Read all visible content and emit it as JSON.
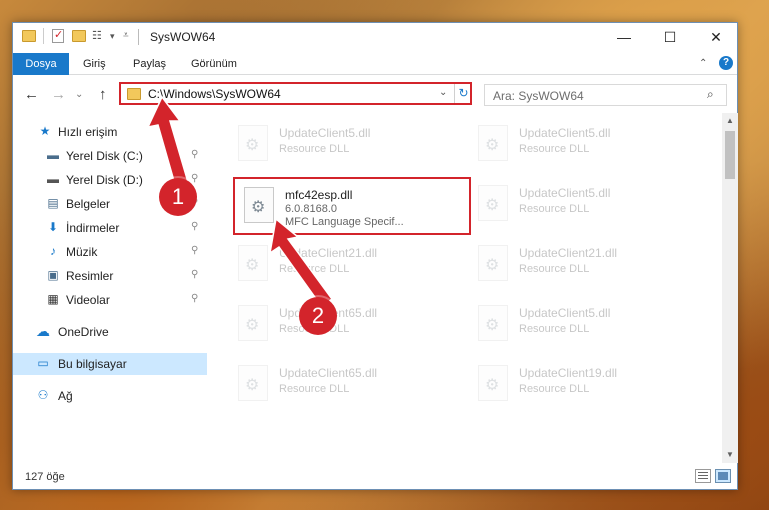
{
  "window": {
    "title": "SysWOW64",
    "min_glyph": "—",
    "max_glyph": "☐",
    "close_glyph": "✕"
  },
  "ribbon": {
    "tabs": [
      "Dosya",
      "Giriş",
      "Paylaş",
      "Görünüm"
    ],
    "collapse_glyph": "⌃",
    "help_glyph": "?"
  },
  "nav": {
    "back_glyph": "←",
    "forward_glyph": "→",
    "recent_glyph": "⌄",
    "up_glyph": "↑"
  },
  "address": {
    "path": "C:\\Windows\\SysWOW64",
    "dropdown_glyph": "⌄",
    "refresh_glyph": "↻"
  },
  "search": {
    "placeholder": "Ara: SysWOW64",
    "icon_glyph": "⌕"
  },
  "sidebar": {
    "items": [
      {
        "label": "Hızlı erişim",
        "icon": "star-icon",
        "glyph": "★",
        "pinned": false
      },
      {
        "label": "Yerel Disk (C:)",
        "icon": "drive-icon",
        "glyph": "▬",
        "pinned": true
      },
      {
        "label": "Yerel Disk (D:)",
        "icon": "drive-icon",
        "glyph": "▬",
        "pinned": true
      },
      {
        "label": "Belgeler",
        "icon": "documents-icon",
        "glyph": "▤",
        "pinned": true
      },
      {
        "label": "İndirmeler",
        "icon": "download-icon",
        "glyph": "⬇",
        "pinned": true
      },
      {
        "label": "Müzik",
        "icon": "music-icon",
        "glyph": "♪",
        "pinned": true
      },
      {
        "label": "Resimler",
        "icon": "pictures-icon",
        "glyph": "▣",
        "pinned": true
      },
      {
        "label": "Videolar",
        "icon": "video-icon",
        "glyph": "▦",
        "pinned": true
      },
      {
        "label": "OneDrive",
        "icon": "onedrive-icon",
        "glyph": "☁",
        "pinned": false
      },
      {
        "label": "Bu bilgisayar",
        "icon": "computer-icon",
        "glyph": "▭",
        "pinned": false
      },
      {
        "label": "Ağ",
        "icon": "network-icon",
        "glyph": "⚇",
        "pinned": false
      }
    ],
    "pin_glyph": "📌"
  },
  "files": [
    {
      "name": "UpdateClient5.dll",
      "desc": "Resource DLL",
      "faded": true
    },
    {
      "name": "UpdateClient5.dll",
      "desc": "Resource DLL",
      "faded": true
    },
    {
      "name": "mfc42esp.dll",
      "version": "6.0.8168.0",
      "desc": "MFC Language Specif...",
      "faded": false,
      "highlighted": true
    },
    {
      "name": "UpdateClient5.dll",
      "desc": "Resource DLL",
      "faded": true
    },
    {
      "name": "UpdateClient21.dll",
      "desc": "Resource DLL",
      "faded": true
    },
    {
      "name": "UpdateClient21.dll",
      "desc": "Resource DLL",
      "faded": true
    },
    {
      "name": "UpdateClient65.dll",
      "desc": "Resource DLL",
      "faded": true
    },
    {
      "name": "UpdateClient5.dll",
      "desc": "Resource DLL",
      "faded": true
    },
    {
      "name": "UpdateClient65.dll",
      "desc": "Resource DLL",
      "faded": true
    },
    {
      "name": "UpdateClient19.dll",
      "desc": "Resource DLL",
      "faded": true
    }
  ],
  "status": {
    "count": "127 öğe"
  },
  "annotations": {
    "badge1": "1",
    "badge2": "2",
    "color": "#d3242b"
  },
  "colors": {
    "accent": "#1979ca",
    "selection": "#cce8ff",
    "highlight_border": "#d3242b"
  }
}
